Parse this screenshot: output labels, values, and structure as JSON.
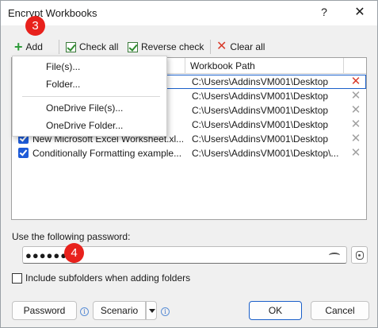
{
  "window": {
    "title": "Encrypt Workbooks",
    "help": "?",
    "close": "✕"
  },
  "toolbar": {
    "add_label": "Add",
    "check_all_label": "Check all",
    "reverse_check_label": "Reverse check",
    "clear_all_label": "Clear all"
  },
  "add_menu": {
    "items": [
      "File(s)...",
      "Folder...",
      "OneDrive File(s)...",
      "OneDrive Folder..."
    ]
  },
  "grid": {
    "columns": [
      "",
      "Workbook Path"
    ],
    "rows": [
      {
        "name": "",
        "path": "C:\\Users\\AddinsVM001\\Desktop",
        "checked": true
      },
      {
        "name": "",
        "path": "C:\\Users\\AddinsVM001\\Desktop",
        "checked": true
      },
      {
        "name": "",
        "path": "C:\\Users\\AddinsVM001\\Desktop",
        "checked": true
      },
      {
        "name": "",
        "path": "C:\\Users\\AddinsVM001\\Desktop",
        "checked": true
      },
      {
        "name": "New Microsoft Excel Worksheet.xl...",
        "path": "C:\\Users\\AddinsVM001\\Desktop",
        "checked": true
      },
      {
        "name": "Conditionally Formatting example...",
        "path": "C:\\Users\\AddinsVM001\\Desktop\\...",
        "checked": true
      }
    ]
  },
  "password": {
    "label": "Use the following password:",
    "value": "●●●●●●"
  },
  "include_subfolders": {
    "label": "Include subfolders when adding folders",
    "checked": false
  },
  "footer": {
    "password_button": "Password",
    "scenario_button": "Scenario",
    "ok_button": "OK",
    "cancel_button": "Cancel"
  },
  "callouts": {
    "step3": "3",
    "step4": "4"
  },
  "colors": {
    "accent": "#1e5bd8",
    "callout": "#e8211c",
    "delete_active": "#d83b2b"
  }
}
